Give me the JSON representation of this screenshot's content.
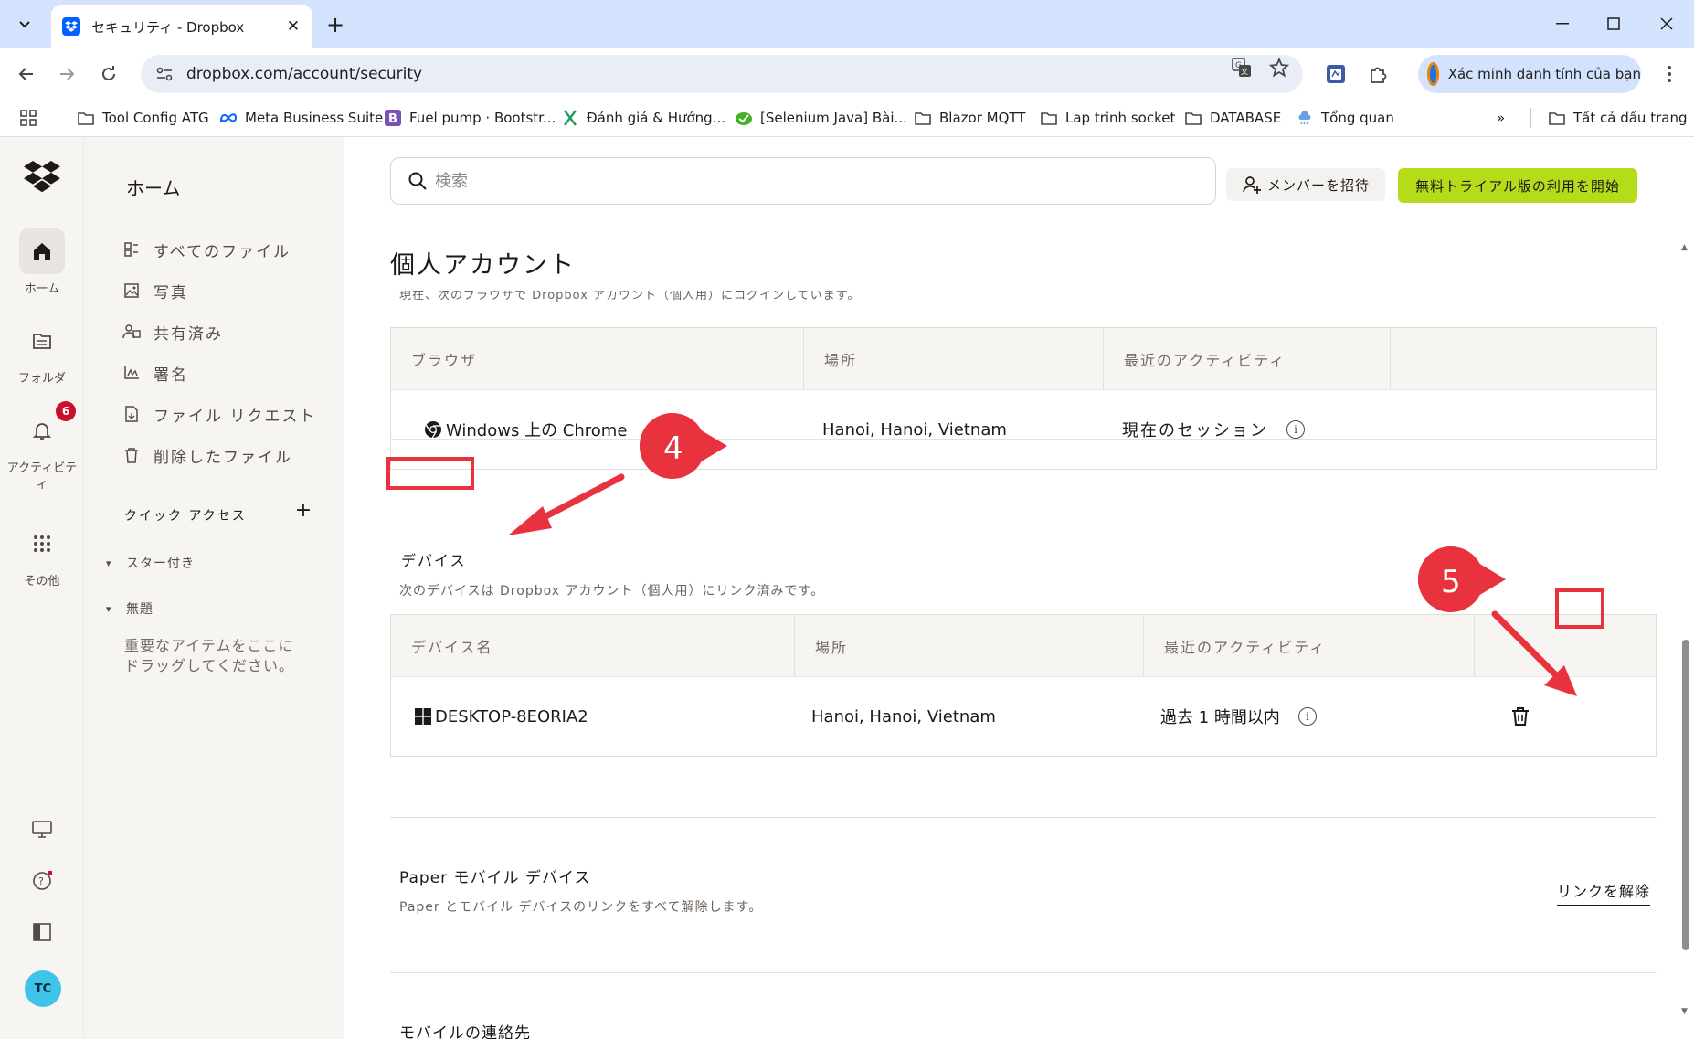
{
  "browser": {
    "tab_title": "セキュリティ - Dropbox",
    "url": "dropbox.com/account/security",
    "profile_label": "Xác minh danh tính của bạn",
    "bookmarks": [
      {
        "label": "Tool Config ATG",
        "icon": "folder-icon"
      },
      {
        "label": "Meta Business Suite",
        "icon": "meta-icon"
      },
      {
        "label": "Fuel pump · Bootstr...",
        "icon": "bootstrap-icon"
      },
      {
        "label": "Đánh giá & Hướng...",
        "icon": "x-icon"
      },
      {
        "label": "[Selenium Java] Bài...",
        "icon": "selenium-icon"
      },
      {
        "label": "Blazor MQTT",
        "icon": "folder-icon"
      },
      {
        "label": "Lap trinh socket",
        "icon": "folder-icon"
      },
      {
        "label": "DATABASE",
        "icon": "folder-icon"
      },
      {
        "label": "Tổng quan",
        "icon": "cloud-icon"
      }
    ],
    "all_bookmarks": "Tất cả dấu trang",
    "more_bookmarks": "»"
  },
  "rail": {
    "home": "ホーム",
    "folders": "フォルダ",
    "activity": "アクティビティ",
    "activity_badge": "6",
    "more": "その他",
    "avatar_initials": "TC"
  },
  "sidebar": {
    "title": "ホーム",
    "items": [
      {
        "label": "すべてのファイル",
        "icon": "all-files-icon"
      },
      {
        "label": "写真",
        "icon": "photos-icon"
      },
      {
        "label": "共有済み",
        "icon": "shared-icon"
      },
      {
        "label": "署名",
        "icon": "signature-icon"
      },
      {
        "label": "ファイル リクエスト",
        "icon": "file-request-icon"
      },
      {
        "label": "削除したファイル",
        "icon": "trash-icon"
      }
    ],
    "quick_access": "クイック アクセス",
    "groups": [
      "スター付き",
      "無題"
    ],
    "drag_hint": "重要なアイテムをここにドラッグしてください。"
  },
  "main": {
    "search_placeholder": "検索",
    "invite_label": "メンバーを招待",
    "trial_label": "無料トライアル版の利用を開始",
    "personal_heading": "個人アカウント",
    "browsers_desc": "現在、次のブラウザで Dropbox アカウント（個人用）にログインしています。",
    "browsers_table": {
      "headers": [
        "ブラウザ",
        "場所",
        "最近のアクティビティ"
      ],
      "rows": [
        {
          "name": "Windows 上の Chrome",
          "location": "Hanoi, Hanoi, Vietnam",
          "activity": "現在のセッション"
        }
      ]
    },
    "devices_title": "デバイス",
    "devices_desc": "次のデバイスは Dropbox アカウント（個人用）にリンク済みです。",
    "devices_table": {
      "headers": [
        "デバイス名",
        "場所",
        "最近のアクティビティ"
      ],
      "rows": [
        {
          "name": "DESKTOP-8EORIA2",
          "location": "Hanoi, Hanoi, Vietnam",
          "activity": "過去 1 時間以内"
        }
      ]
    },
    "paper_title": "Paper モバイル デバイス",
    "paper_desc": "Paper とモバイル デバイスのリンクをすべて解除します。",
    "unlink_label": "リンクを解除",
    "mobile_contacts": "モバイルの連絡先"
  },
  "annotations": {
    "step4": "4",
    "step5": "5",
    "color": "#e8333f"
  },
  "colors": {
    "accent_green": "#b4dc19",
    "dropbox_blue": "#0061fe",
    "chrome_tabstrip": "#d3e3fd"
  }
}
